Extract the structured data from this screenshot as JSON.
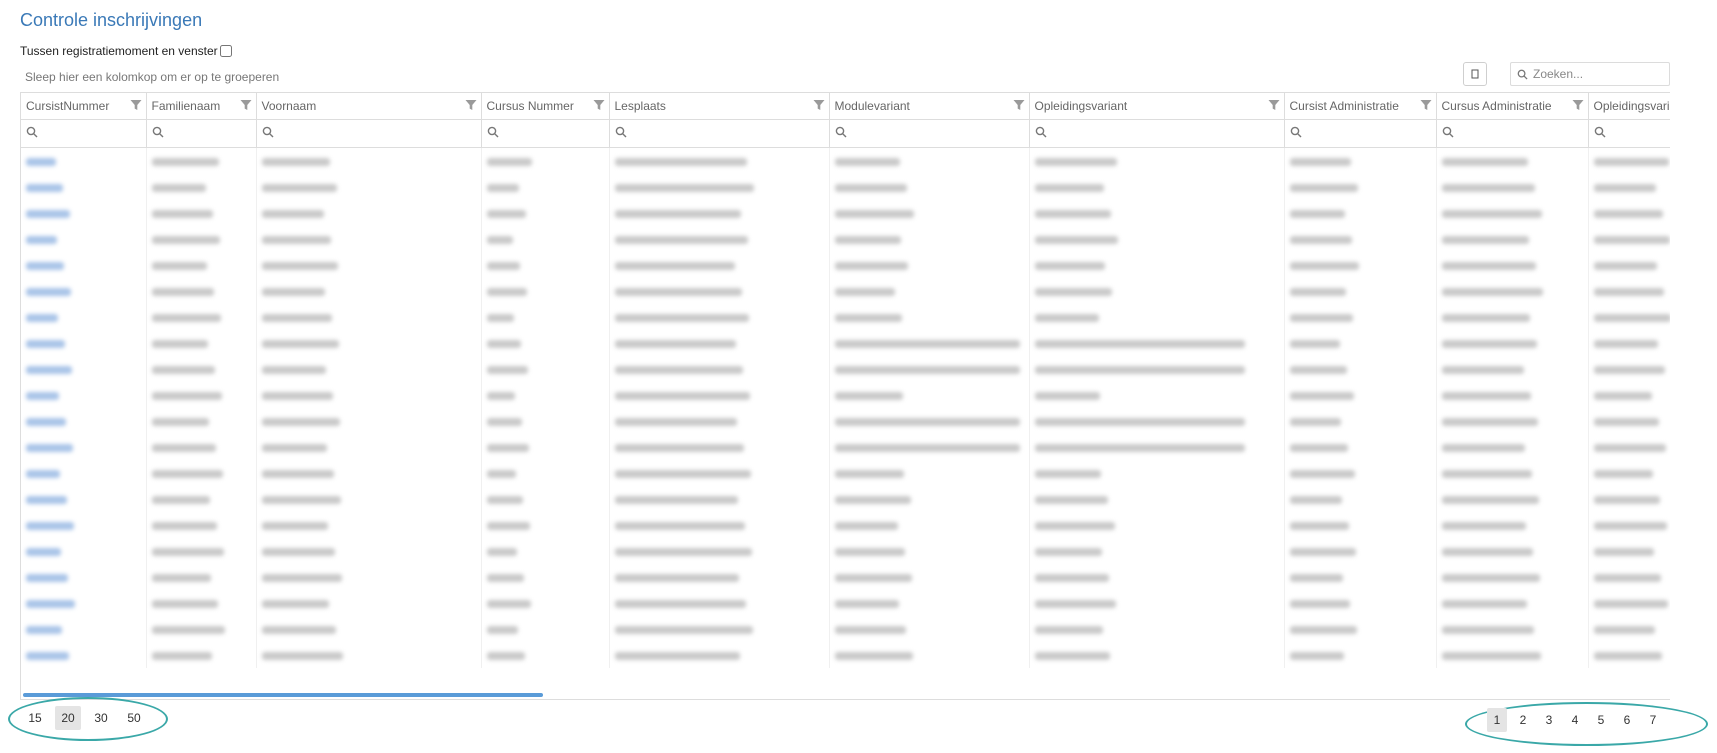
{
  "title": "Controle inschrijvingen",
  "checkbox_label": "Tussen registratiemoment en venster",
  "group_hint": "Sleep hier een kolomkop om er op te groeperen",
  "search_placeholder": "Zoeken...",
  "columns": [
    "CursistNummer",
    "Familienaam",
    "Voornaam",
    "Cursus Nummer",
    "Lesplaats",
    "Modulevariant",
    "Opleidingsvariant",
    "Cursist Administratie",
    "Cursus Administratie",
    "Opleidingsvariant"
  ],
  "page_sizes": [
    "15",
    "20",
    "30",
    "50"
  ],
  "active_page_size": "20",
  "pages": [
    "1",
    "2",
    "3",
    "4",
    "5",
    "6",
    "7"
  ],
  "active_page": "1",
  "colors": {
    "title": "#3a79b7",
    "highlight": "#3aa8a8",
    "scroll": "#5a9bd8"
  },
  "icons": [
    "filter-icon",
    "search-icon",
    "column-chooser-icon"
  ]
}
